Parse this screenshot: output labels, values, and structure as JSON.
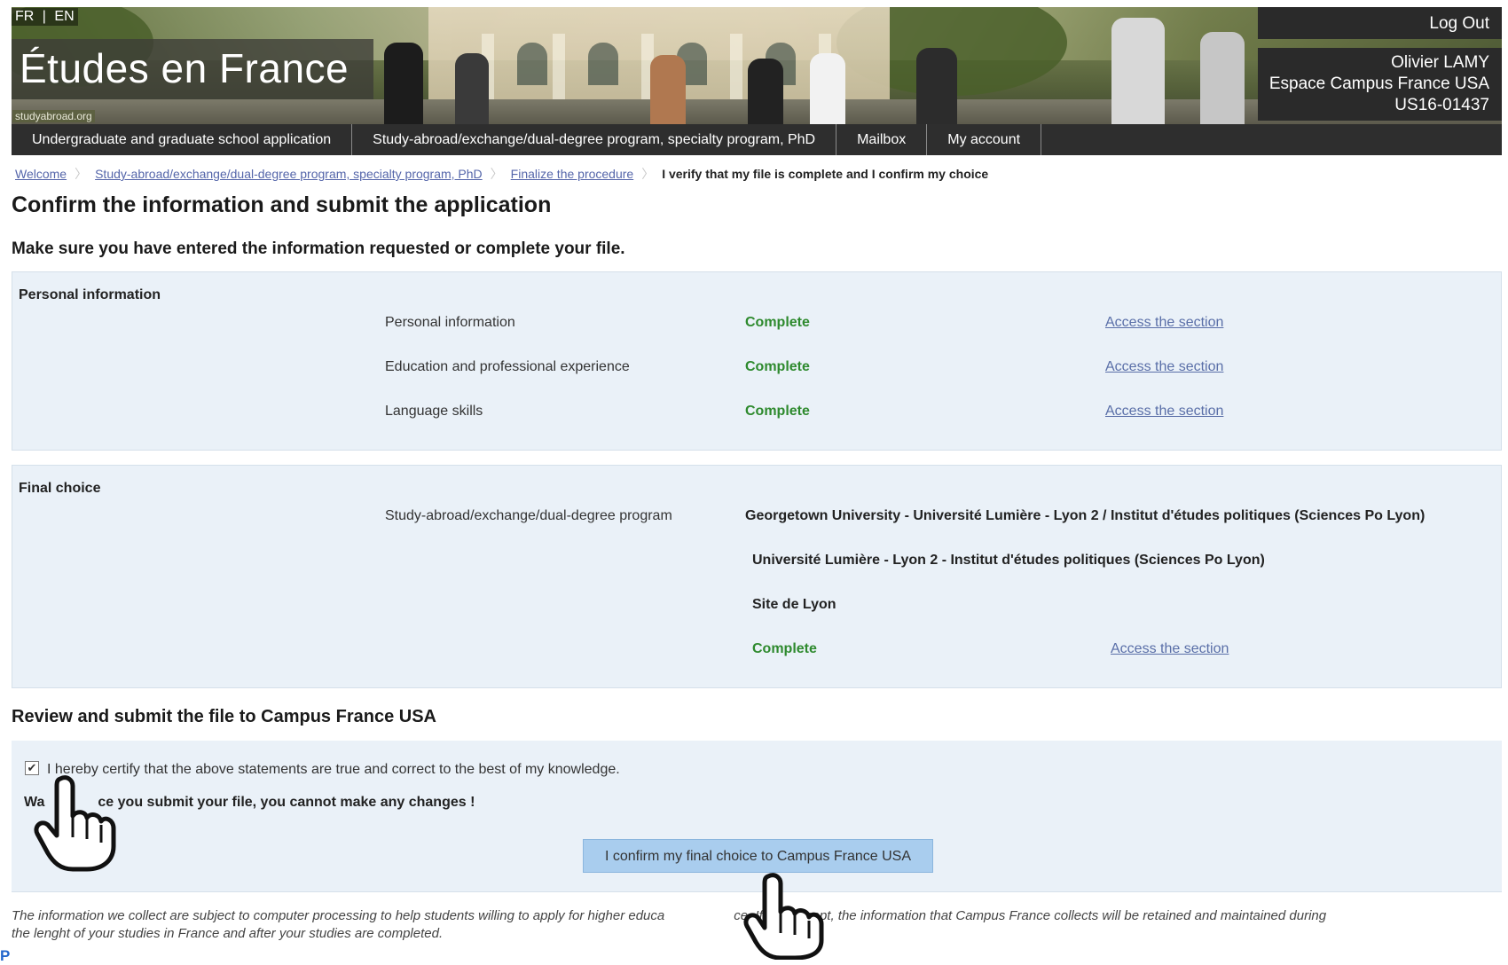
{
  "banner": {
    "lang_fr": "FR",
    "lang_sep": "|",
    "lang_en": "EN",
    "logo_text": "Études en France",
    "watermark": "studyabroad.org",
    "logout_label": "Log Out",
    "user_name": "Olivier LAMY",
    "user_org": "Espace Campus France USA",
    "user_id": "US16-01437"
  },
  "nav": {
    "items": [
      "Undergraduate and graduate school application",
      "Study-abroad/exchange/dual-degree program, specialty program, PhD",
      "Mailbox",
      "My account"
    ]
  },
  "breadcrumb": {
    "items": [
      "Welcome",
      "Study-abroad/exchange/dual-degree program, specialty program, PhD",
      "Finalize the procedure"
    ],
    "current": "I verify that my file is complete and I confirm my choice"
  },
  "page": {
    "title": "Confirm the information and submit the application",
    "subtitle": "Make sure you have entered the information requested or complete your file."
  },
  "personal": {
    "title": "Personal information",
    "rows": [
      {
        "label": "Personal information",
        "status": "Complete",
        "link": "Access the section"
      },
      {
        "label": "Education and professional experience",
        "status": "Complete",
        "link": "Access the section"
      },
      {
        "label": "Language skills",
        "status": "Complete",
        "link": "Access the section"
      }
    ]
  },
  "final": {
    "title": "Final choice",
    "label": "Study-abroad/exchange/dual-degree program",
    "program": "Georgetown University - Université Lumière - Lyon 2 / Institut d'études politiques (Sciences Po Lyon)",
    "institution": "Université Lumière - Lyon 2 - Institut d'études politiques (Sciences Po Lyon)",
    "site": "Site de Lyon",
    "status": "Complete",
    "link": "Access the section"
  },
  "review": {
    "title": "Review and submit the file to Campus France USA",
    "certify_text": "I hereby certify that the above statements are true and correct to the best of my knowledge.",
    "checkbox_mark": "✔",
    "warning_start": "Wa",
    "warning_end": "ce you submit your file, you cannot make any changes !",
    "button_label": "I confirm my final choice to Campus France USA"
  },
  "footer": {
    "text": "The information we collect are subject to computer processing to help students willing to apply for higher educa",
    "text_end": "ce. If you accept, the information that Campus France collects will be retained and maintained during",
    "text_line2": "the lenght of your studies in France and after your studies are completed.",
    "corner": "P"
  },
  "colors": {
    "nav_bg": "#2e2e2e",
    "panel_bg": "#eaf1f8",
    "status_green": "#2e8a2e",
    "link_blue": "#5a6fa8",
    "button_bg": "#a9cdee"
  }
}
